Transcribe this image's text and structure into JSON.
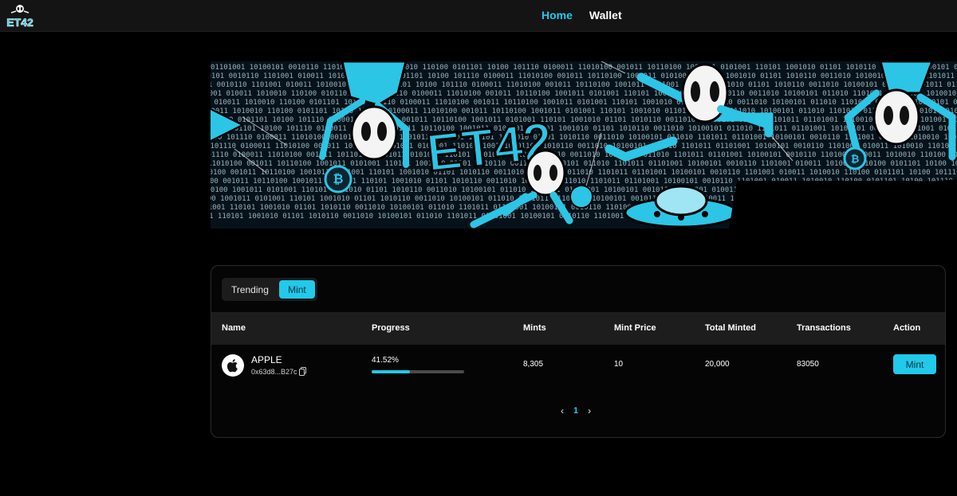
{
  "header": {
    "logo_text": "ET42",
    "nav": [
      {
        "label": "Home",
        "active": true
      },
      {
        "label": "Wallet",
        "active": false
      }
    ]
  },
  "banner": {
    "title": "ET42",
    "binary": "01101001 10100101 0010110 1101001 010011 1010010 110100 0101101 10100 101110 0100011 11010100 001011 10110100 1001011 0101001 110101 1001010 01101 1010110 0011010 10100101 011010 1101011"
  },
  "tabs": {
    "trending_label": "Trending",
    "mint_label": "Mint",
    "active": "Mint"
  },
  "table": {
    "headers": {
      "name": "Name",
      "progress": "Progress",
      "mints": "Mints",
      "mint_price": "Mint Price",
      "total_minted": "Total Minted",
      "transactions": "Transactions",
      "action": "Action"
    },
    "rows": [
      {
        "icon": "apple-icon",
        "name": "APPLE",
        "address": "0x63d8...B27c",
        "progress_label": "41.52%",
        "progress_fraction": 0.4152,
        "mints": "8,305",
        "mint_price": "10",
        "total_minted": "20,000",
        "transactions": "83050",
        "action_label": "Mint"
      }
    ]
  },
  "pagination": {
    "prev": "‹",
    "current": "1",
    "next": "›"
  },
  "colors": {
    "accent": "#21c9ea",
    "background": "#000000",
    "header_bg": "#141414"
  }
}
